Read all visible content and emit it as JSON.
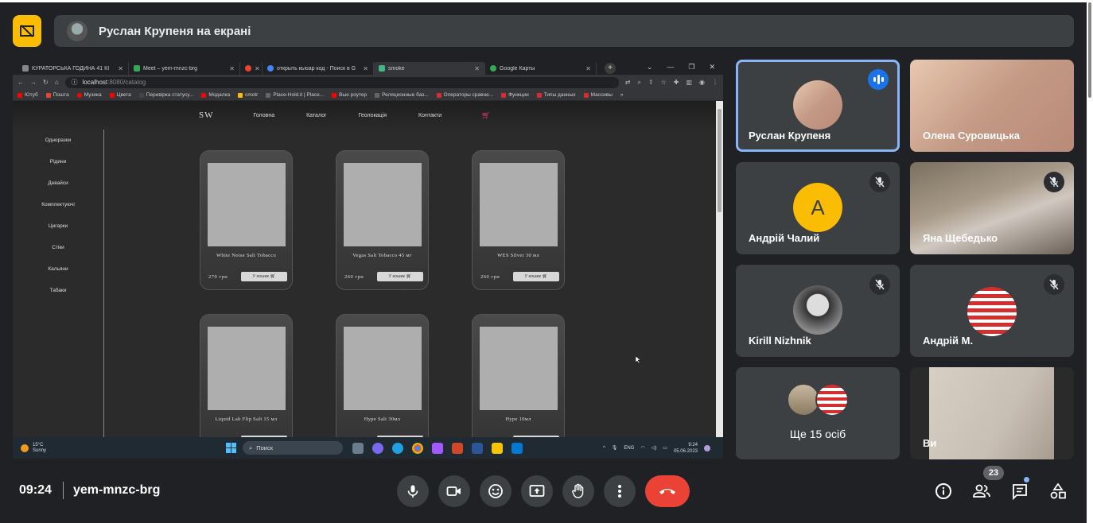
{
  "presenting": {
    "text": "Руслан Крупеня на екрані"
  },
  "browser": {
    "tabs": [
      {
        "label": "КУРАТОРСЬКА ГОДИНА 41 КІ",
        "color": "#888"
      },
      {
        "label": "Meet – yem-mnzc-brg",
        "color": "#34a853"
      },
      {
        "label": "",
        "color": "#ea4335"
      },
      {
        "label": "открыть кьюар код - Поиск в G",
        "color": "#4285f4"
      },
      {
        "label": "smoke",
        "color": "#41b883"
      },
      {
        "label": "Google Карты",
        "color": "#34a853"
      }
    ],
    "url_host": "localhost",
    "url_path": ":8080/catalog",
    "bookmarks": [
      {
        "label": "Ютуб",
        "color": "#ff0000"
      },
      {
        "label": "Пошта",
        "color": "#ea4335"
      },
      {
        "label": "Музика",
        "color": "#ff0000"
      },
      {
        "label": "Цвета",
        "color": "#ff0000"
      },
      {
        "label": "Перевірка статусу...",
        "color": "#444"
      },
      {
        "label": "Модалка",
        "color": "#ff0000"
      },
      {
        "label": "cmotr",
        "color": "#fbbc04"
      },
      {
        "label": "Place-Hold.it | Place...",
        "color": "#666"
      },
      {
        "label": "Вью роутер",
        "color": "#ff0000"
      },
      {
        "label": "Реляционные баз...",
        "color": "#666"
      },
      {
        "label": "Операторы сравне...",
        "color": "#d32f2f"
      },
      {
        "label": "Функции",
        "color": "#d32f2f"
      },
      {
        "label": "Типы данных",
        "color": "#d32f2f"
      },
      {
        "label": "Массивы",
        "color": "#d32f2f"
      }
    ]
  },
  "site": {
    "logo": "SW",
    "nav": [
      "Головна",
      "Каталог",
      "Геолокація",
      "Контакти"
    ],
    "categories": [
      "Одноразки",
      "Рідини",
      "Девайси",
      "Комплектуючі",
      "Цигарки",
      "Стіки",
      "Кальяни",
      "Табаки"
    ],
    "cart_label": "У кошик",
    "products": [
      {
        "name": "White Noise Salt Tobacco",
        "price": "270 грн"
      },
      {
        "name": "Vegas Salt Tobacco 45 мг",
        "price": "260 грн"
      },
      {
        "name": "WES Silver 30 мл",
        "price": "260 грн"
      },
      {
        "name": "Liquid Lab Flip Salt 15 мл",
        "price": ""
      },
      {
        "name": "Hype Salt 30мл",
        "price": ""
      },
      {
        "name": "Hype 10мл",
        "price": ""
      }
    ]
  },
  "taskbar": {
    "temp": "15°C",
    "weather": "Sunny",
    "search": "Поиск",
    "lang": "ENG",
    "time": "9:24",
    "date": "05.06.2023"
  },
  "participants": [
    {
      "name": "Руслан Крупеня"
    },
    {
      "name": "Олена Суровицька"
    },
    {
      "name": "Андрій Чалий",
      "letter": "А"
    },
    {
      "name": "Яна Щебедько"
    },
    {
      "name": "Kirill Nizhnik"
    },
    {
      "name": "Андрій М."
    },
    {
      "name": "Ви"
    }
  ],
  "more": {
    "text": "Ще 15 осіб"
  },
  "meeting": {
    "time": "09:24",
    "code": "yem-mnzc-brg",
    "people_count": "23"
  },
  "colors": {
    "accent": "#8ab4f8",
    "end_call": "#ea4335",
    "present": "#fbbc04"
  }
}
